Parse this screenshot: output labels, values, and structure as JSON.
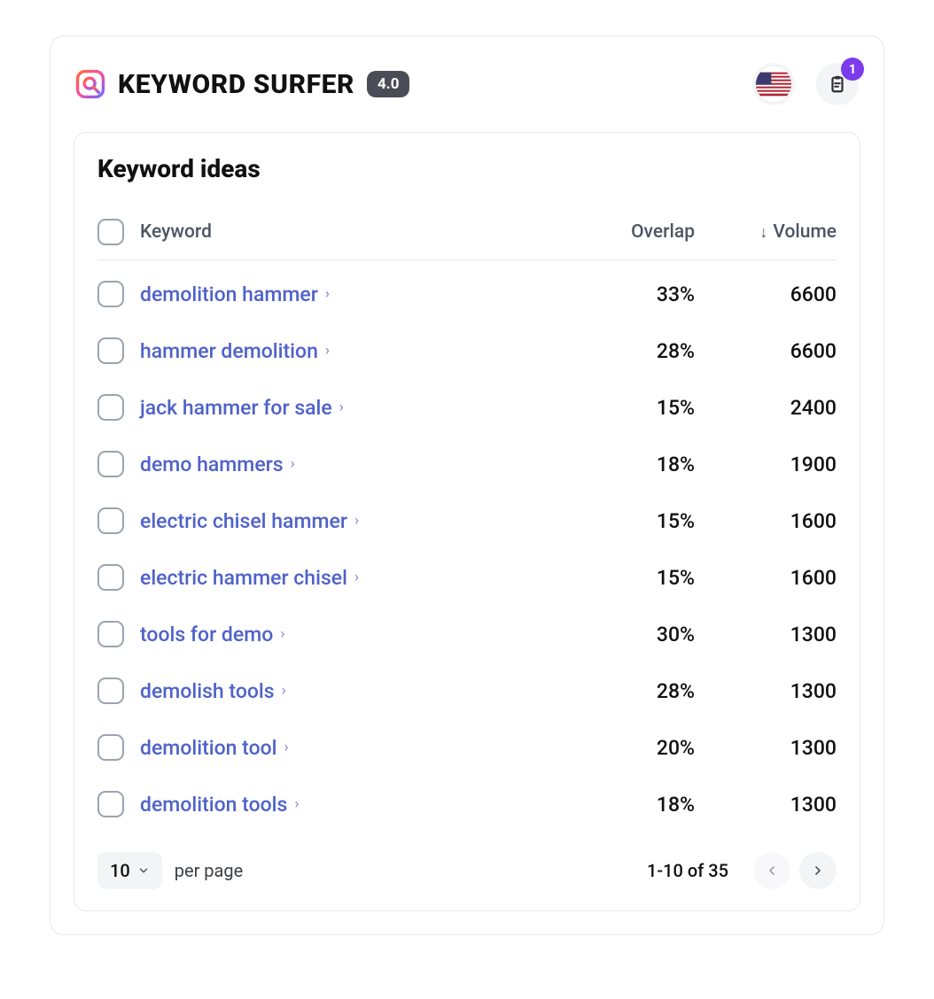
{
  "header": {
    "title": "KEYWORD SURFER",
    "version": "4.0",
    "country": "US",
    "clipboard_count": "1"
  },
  "panel": {
    "title": "Keyword ideas",
    "columns": {
      "keyword": "Keyword",
      "overlap": "Overlap",
      "volume": "Volume"
    },
    "sort": {
      "column": "volume",
      "direction": "desc"
    },
    "ideas": [
      {
        "keyword": "demolition hammer",
        "overlap": "33%",
        "volume": "6600"
      },
      {
        "keyword": "hammer demolition",
        "overlap": "28%",
        "volume": "6600"
      },
      {
        "keyword": "jack hammer for sale",
        "overlap": "15%",
        "volume": "2400"
      },
      {
        "keyword": "demo hammers",
        "overlap": "18%",
        "volume": "1900"
      },
      {
        "keyword": "electric chisel hammer",
        "overlap": "15%",
        "volume": "1600"
      },
      {
        "keyword": "electric hammer chisel",
        "overlap": "15%",
        "volume": "1600"
      },
      {
        "keyword": "tools for demo",
        "overlap": "30%",
        "volume": "1300"
      },
      {
        "keyword": "demolish tools",
        "overlap": "28%",
        "volume": "1300"
      },
      {
        "keyword": "demolition tool",
        "overlap": "20%",
        "volume": "1300"
      },
      {
        "keyword": "demolition tools",
        "overlap": "18%",
        "volume": "1300"
      }
    ],
    "pagination": {
      "page_size": "10",
      "per_page_label": "per page",
      "range": "1-10 of 35"
    }
  }
}
